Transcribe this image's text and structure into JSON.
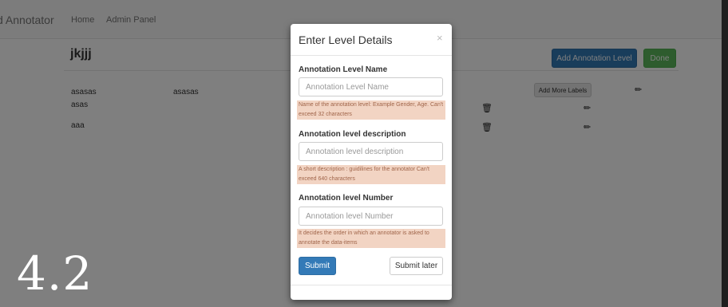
{
  "navbar": {
    "brand": "d Annotator",
    "home": "Home",
    "admin_panel": "Admin Panel"
  },
  "page": {
    "title": "jkjjj",
    "add_level_button": "Add Annotation Level",
    "done_button": "Done",
    "add_more_labels_button": "Add More Labels",
    "rows": [
      {
        "name": "asasas",
        "desc": "asasas"
      },
      {
        "name": "asas",
        "desc": ""
      },
      {
        "name": "aaa",
        "desc": ""
      }
    ],
    "watermark": "4.2"
  },
  "modal": {
    "title": "Enter Level Details",
    "close": "×",
    "name_label": "Annotation Level Name",
    "name_placeholder": "Annotation Level Name",
    "name_hint": "Name of the annotation level: Example Gender, Age. Can't exceed 32 characters",
    "desc_label": "Annotation level description",
    "desc_placeholder": "Annotation level description",
    "desc_hint": "A short description : guidilines for the annotator Can't exceed 640 characters",
    "number_label": "Annotation level Number",
    "number_placeholder": "Annotation level Number",
    "number_hint": "It decides the order in which an annotator is asked to annotate the data-items",
    "submit": "Submit",
    "submit_later": "Submit later"
  },
  "icons": {
    "trash": "trash-icon",
    "pencil": "pencil-icon"
  }
}
